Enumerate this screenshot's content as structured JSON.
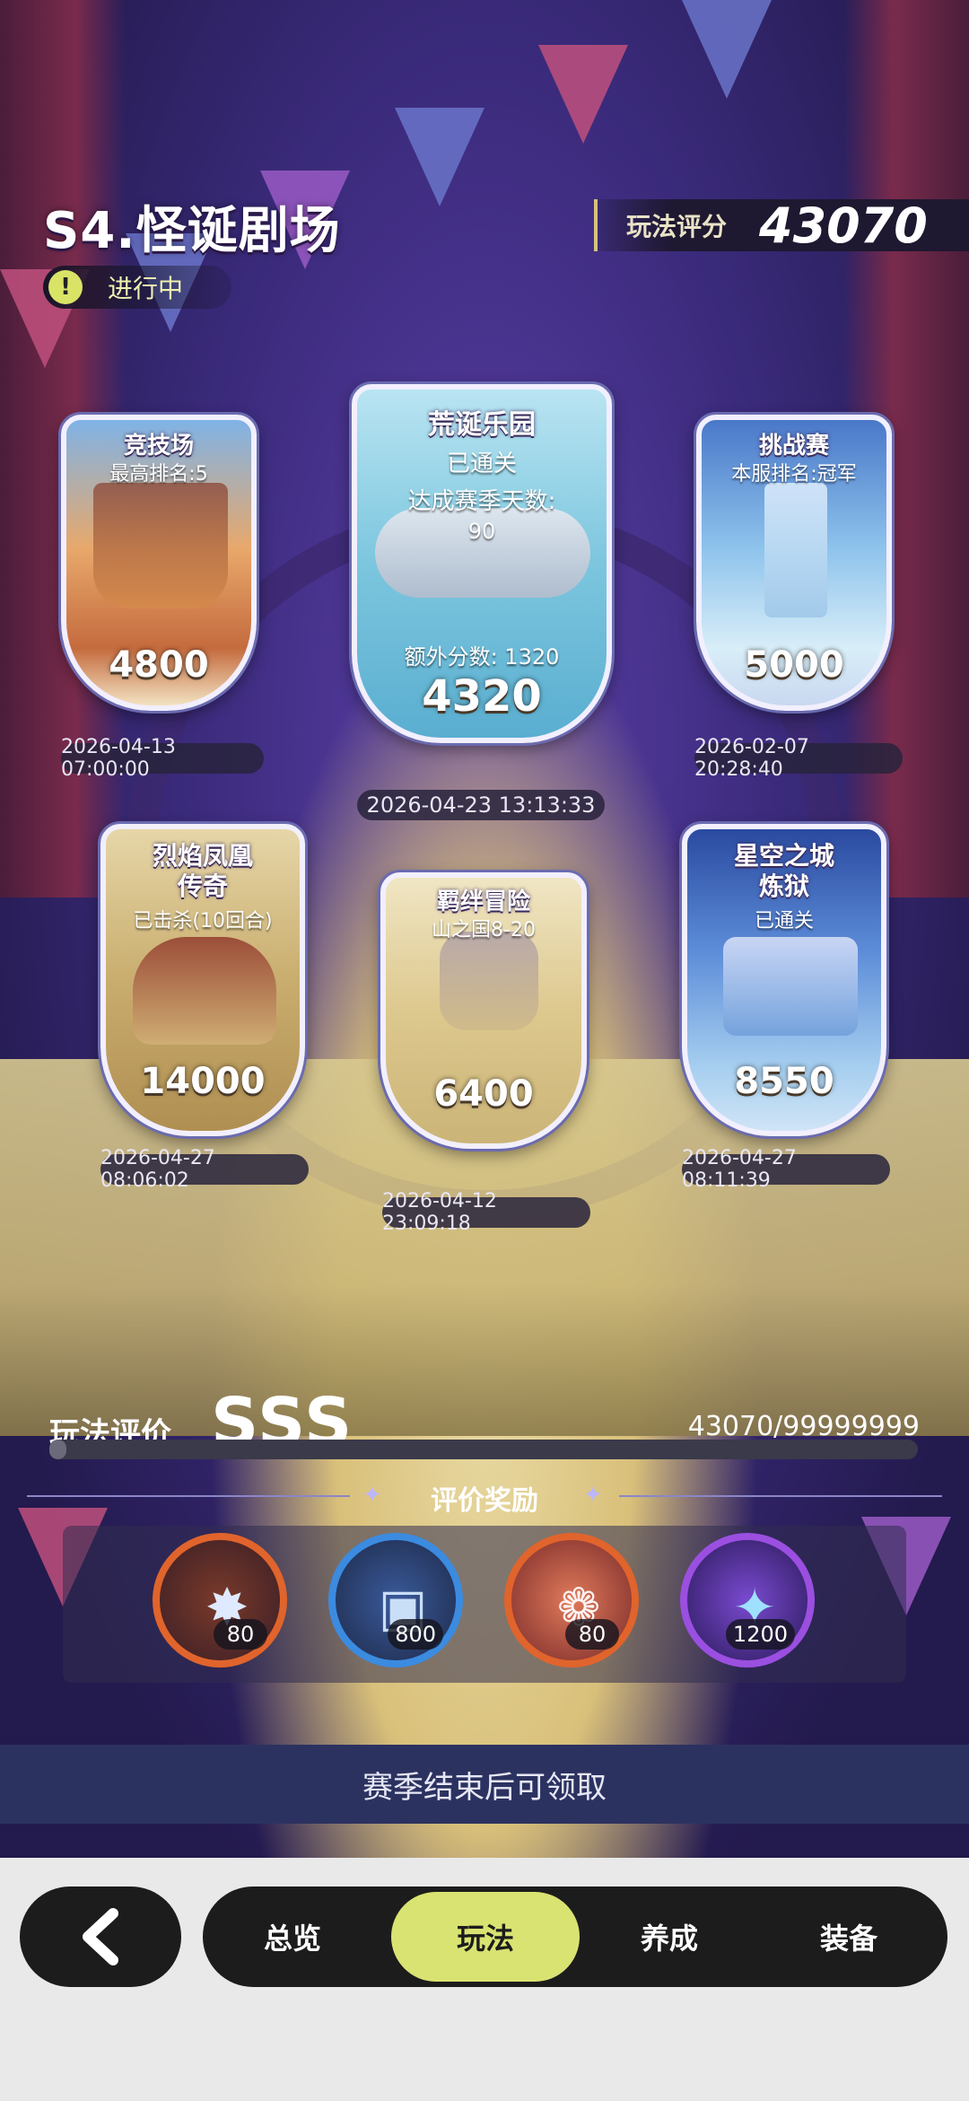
{
  "header": {
    "title": "S4.怪诞剧场",
    "status": "进行中",
    "status_icon": "!",
    "score_label": "玩法评分",
    "score_value": "43070"
  },
  "cards": [
    {
      "title": "竞技场",
      "subtitle": "最高排名:5",
      "points": "4800",
      "timestamp": "2026-04-13 07:00:00"
    },
    {
      "title": "荒诞乐园",
      "subtitle": "已通关",
      "detail1": "达成赛季天数:",
      "detail2": "90",
      "extra": "额外分数: 1320",
      "points": "4320",
      "timestamp": "2026-04-23 13:13:33"
    },
    {
      "title": "挑战赛",
      "subtitle": "本服排名:冠军",
      "points": "5000",
      "timestamp": "2026-02-07 20:28:40"
    },
    {
      "title_line1": "烈焰凤凰",
      "title_line2": "传奇",
      "subtitle": "已击杀(10回合)",
      "points": "14000",
      "timestamp": "2026-04-27 08:06:02"
    },
    {
      "title": "羁绊冒险",
      "subtitle": "山之国8-20",
      "points": "6400",
      "timestamp": "2026-04-12 23:09:18"
    },
    {
      "title_line1": "星空之城",
      "title_line2": "炼狱",
      "subtitle": "已通关",
      "points": "8550",
      "timestamp": "2026-04-27 08:11:39"
    }
  ],
  "evaluation": {
    "label": "玩法评价",
    "grade": "SSS",
    "progress_text": "43070/99999999",
    "progress_fraction": 0.0004
  },
  "rewards": {
    "title": "评价奖励",
    "items": [
      {
        "icon": "crystal-star-icon",
        "qty": "80",
        "color": "#e0642c"
      },
      {
        "icon": "card-pack-icon",
        "qty": "800",
        "color": "#3b8be0"
      },
      {
        "icon": "paw-charm-icon",
        "qty": "80",
        "color": "#e0642c"
      },
      {
        "icon": "moon-star-orb-icon",
        "qty": "1200",
        "color": "#9a4fe0"
      }
    ]
  },
  "claim_text": "赛季结束后可领取",
  "nav": {
    "tabs": [
      "总览",
      "玩法",
      "养成",
      "装备"
    ],
    "active": "玩法"
  }
}
